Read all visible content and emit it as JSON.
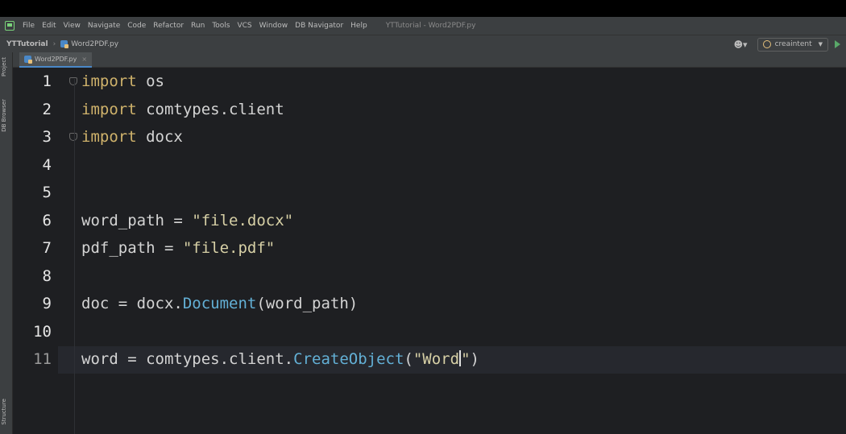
{
  "window_title": "YTTutorial - Word2PDF.py",
  "menu": [
    "File",
    "Edit",
    "View",
    "Navigate",
    "Code",
    "Refactor",
    "Run",
    "Tools",
    "VCS",
    "Window",
    "DB Navigator",
    "Help"
  ],
  "breadcrumb": {
    "project": "YTTutorial",
    "file": "Word2PDF.py"
  },
  "run_config": "creaintent",
  "side_tabs": {
    "project": "Project",
    "db_browser": "DB Browser",
    "structure": "Structure"
  },
  "editor_tab": "Word2PDF.py",
  "line_numbers": [
    "1",
    "2",
    "3",
    "4",
    "5",
    "6",
    "7",
    "8",
    "9",
    "10",
    "11"
  ],
  "code": {
    "l1": {
      "kw": "import",
      "mod": " os"
    },
    "l2": {
      "kw": "import",
      "mod": " comtypes.client"
    },
    "l3": {
      "kw": "import",
      "mod": " docx"
    },
    "l6": {
      "var": "word_path",
      "op": " = ",
      "str": "\"file.docx\""
    },
    "l7": {
      "var": "pdf_path",
      "op": " = ",
      "str": "\"file.pdf\""
    },
    "l9": {
      "var": "doc",
      "op": " = ",
      "obj": "docx.",
      "fn": "Document",
      "args": "(word_path)"
    },
    "l11": {
      "var": "word",
      "op": " = ",
      "obj": "comtypes.client.",
      "fn": "CreateObject",
      "open": "(",
      "str": "\"Word",
      "str_end": "\"",
      "close": ")"
    }
  },
  "colors": {
    "keyword": "#cfb26b",
    "string": "#d7d0a6",
    "function": "#63b0d6",
    "editor_bg": "#1e1f22",
    "chrome_bg": "#3c3f41"
  }
}
